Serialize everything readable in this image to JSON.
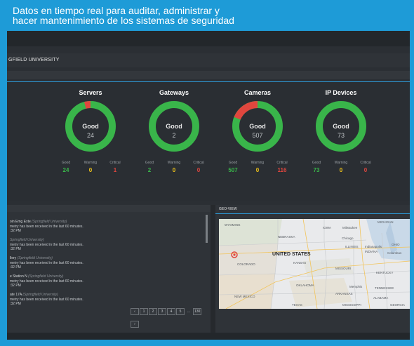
{
  "headline": {
    "line1": "Datos en tiempo real para auditar, administrar y",
    "line2": "hacer mantenimiento de los sistemas de seguridad"
  },
  "site": {
    "name": "GFIELD UNIVERSITY"
  },
  "colors": {
    "good": "#39b54a",
    "warning": "#f0c419",
    "critical": "#e0463e",
    "accent": "#2d9ad8"
  },
  "legend_labels": {
    "good": "Good",
    "warning": "Warning",
    "critical": "Critical"
  },
  "gauges": [
    {
      "name": "Servers",
      "status": "Good",
      "total": "24",
      "good": "24",
      "warning": "0",
      "critical": "1",
      "critical_share": 0.04
    },
    {
      "name": "Gateways",
      "status": "Good",
      "total": "2",
      "good": "2",
      "warning": "0",
      "critical": "0",
      "critical_share": 0
    },
    {
      "name": "Cameras",
      "status": "Good",
      "total": "507",
      "good": "507",
      "warning": "0",
      "critical": "116",
      "critical_share": 0.19
    },
    {
      "name": "IP Devices",
      "status": "Good",
      "total": "73",
      "good": "73",
      "warning": "0",
      "critical": "0",
      "critical_share": 0
    }
  ],
  "alerts": [
    {
      "title": "oin Emg Exte",
      "sub": "(Springfield University)",
      "msg": "metry has been received in the last 60 minutes.",
      "time": ":32 PM"
    },
    {
      "title": "",
      "sub": "Springfield University)",
      "msg": "metry has been received in the last 60 minutes.",
      "time": ":32 PM"
    },
    {
      "title": "llery",
      "sub": "(Springfield University)",
      "msg": "metry has been received in the last 60 minutes.",
      "time": ":32 PM"
    },
    {
      "title": "e Station N",
      "sub": "(Springfield University)",
      "msg": "metry has been received in the last 60 minutes.",
      "time": ":32 PM"
    },
    {
      "title": "ate 17A",
      "sub": "(Springfield University)",
      "msg": "metry has been received in the last 60 minutes.",
      "time": ":32 PM"
    }
  ],
  "pager": {
    "prev": "‹",
    "pages": [
      "1",
      "2",
      "3",
      "4",
      "5"
    ],
    "ellipsis": "...",
    "last": "130",
    "next": "›"
  },
  "geoview": {
    "title": "GEO-VIEW",
    "country": "UNITED STATES",
    "states": [
      "WYOMING",
      "IOWA",
      "NEBRASKA",
      "Chicago",
      "ILLINOIS",
      "Indianapolis",
      "OHIO",
      "INDIANA",
      "Columbus",
      "MICHIGAN",
      "Milwaukee",
      "COLORADO",
      "KANSAS",
      "MISSOURI",
      "KENTUCKY",
      "OKLAHOMA",
      "Memphis",
      "TENNESSEE",
      "ARKANSAS",
      "NEW MEXICO",
      "ALABAMA",
      "TEXAS",
      "MISSISSIPPI",
      "GEORGIA"
    ]
  }
}
